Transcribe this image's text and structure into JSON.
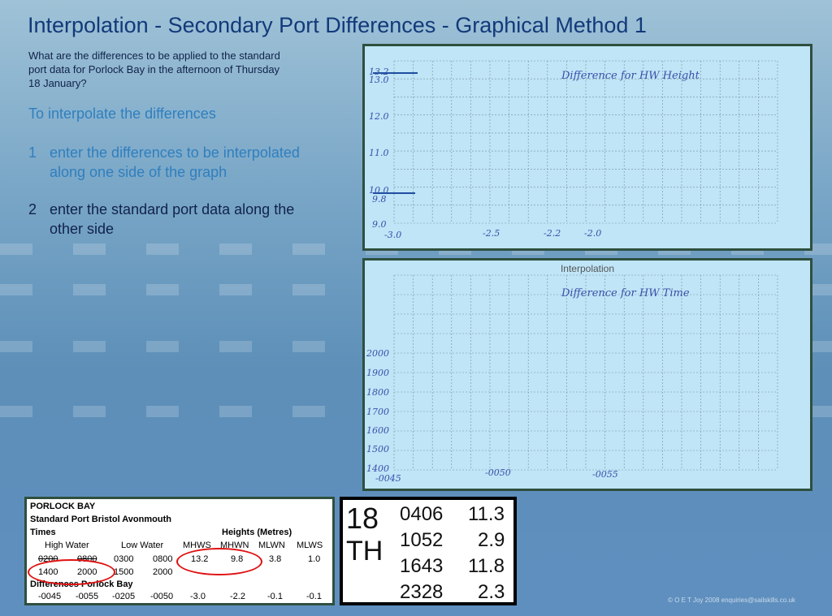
{
  "title": "Interpolation - Secondary Port Differences - Graphical Method 1",
  "question": "What are the differences to be applied to the standard port data for Porlock Bay in the afternoon of Thursday 18 January?",
  "intro": "To interpolate the differences",
  "steps": [
    {
      "num": "1",
      "text": "enter the differences to be interpolated along one side of the graph"
    },
    {
      "num": "2",
      "text": "enter the standard port data along the other side"
    }
  ],
  "graph_height": {
    "caption": "Difference for HW Height",
    "y_labels": [
      "13.2",
      "13.0",
      "12.0",
      "11.0",
      "10.0",
      "9.8",
      "9.0"
    ],
    "x_labels": [
      "-3.0",
      "-2.5",
      "-2.2",
      "-2.0"
    ]
  },
  "graph_time": {
    "title": "Interpolation",
    "caption": "Difference for HW Time",
    "y_labels": [
      "2000",
      "1900",
      "1800",
      "1700",
      "1600",
      "1500",
      "1400"
    ],
    "x_labels": [
      "-0045",
      "-0050",
      "-0055"
    ]
  },
  "port_table": {
    "name": "PORLOCK BAY",
    "standard_port": "Standard Port Bristol Avonmouth",
    "times_label": "Times",
    "heights_label": "Heights (Metres)",
    "high_water": "High Water",
    "low_water": "Low Water",
    "cols": [
      "MHWS",
      "MHWN",
      "MLWN",
      "MLWS"
    ],
    "row1": [
      "0200",
      "0800",
      "0300",
      "0800",
      "13.2",
      "9.8",
      "3.8",
      "1.0"
    ],
    "row2": [
      "1400",
      "2000",
      "1500",
      "2000"
    ],
    "differences_label": "Differences Porlock Bay",
    "row3": [
      "-0045",
      "-0055",
      "-0205",
      "-0050",
      "-3.0",
      "-2.2",
      "-0.1",
      "-0.1"
    ]
  },
  "tide_times": {
    "day": "18",
    "suffix": "TH",
    "entries": [
      {
        "time": "0406",
        "height": "11.3"
      },
      {
        "time": "1052",
        "height": "2.9"
      },
      {
        "time": "1643",
        "height": "11.8"
      },
      {
        "time": "2328",
        "height": "2.3"
      }
    ]
  },
  "copyright": "© O E T Joy 2008 enquiries@sailskills.co.uk",
  "colors": {
    "title": "#123a7a",
    "accent": "#2f7fbf",
    "panel": "#bfe5f7",
    "circle": "#e01010"
  }
}
